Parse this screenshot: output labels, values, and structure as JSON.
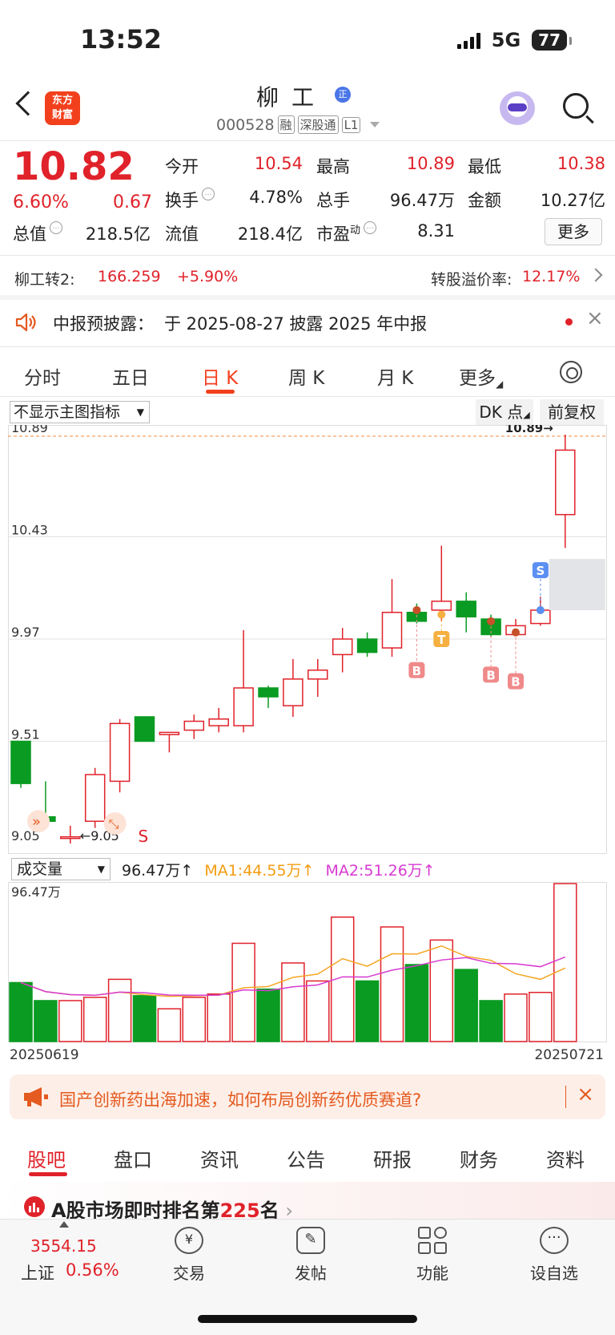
{
  "status_bar": {
    "time": "13:52",
    "network": "5G",
    "battery": "77"
  },
  "header": {
    "logo_line1": "东方",
    "logo_line2": "财富",
    "name": "柳工",
    "badge": "正",
    "code": "000528",
    "tags": [
      "融",
      "深股通",
      "L1"
    ]
  },
  "quote": {
    "price": "10.82",
    "change_pct": "6.60%",
    "change": "0.67",
    "open_label": "今开",
    "open": "10.54",
    "high_label": "最高",
    "high": "10.89",
    "low_label": "最低",
    "low": "10.38",
    "turnover_label": "换手",
    "turnover": "4.78%",
    "volume_label": "总手",
    "volume": "96.47万",
    "amount_label": "金额",
    "amount": "10.27亿",
    "mcap_label": "总值",
    "mcap": "218.5亿",
    "float_label": "流值",
    "float": "218.4亿",
    "pe_label": "市盈",
    "pe_sup": "动",
    "pe": "8.31",
    "more": "更多"
  },
  "convertible": {
    "label": "柳工转2:",
    "price": "166.259",
    "pct": "+5.90%",
    "premium_label": "转股溢价率:",
    "premium": "12.17%"
  },
  "notice": {
    "label": "中报预披露：",
    "text": "于 2025-08-27 披露 2025 年中报"
  },
  "ktabs": [
    "分时",
    "五日",
    "日 K",
    "周 K",
    "月 K",
    "更多"
  ],
  "chart_toolbar": {
    "indicator": "不显示主图指标",
    "dk": "DK 点",
    "adjust": "前复权"
  },
  "chart_data": {
    "type": "candlestick",
    "y_ticks": [
      "10.89",
      "10.43",
      "9.97",
      "9.51",
      "9.05"
    ],
    "ylim": [
      9.05,
      10.89
    ],
    "high_marker": "10.89→",
    "low_marker": "←9.05",
    "signals": [
      "B",
      "T",
      "B",
      "B",
      "S",
      "S"
    ],
    "candles": [
      {
        "o": 9.51,
        "c": 9.32,
        "h": 9.51,
        "l": 9.3
      },
      {
        "o": 9.17,
        "c": 9.15,
        "h": 9.33,
        "l": 9.12
      },
      {
        "o": 9.08,
        "c": 9.08,
        "h": 9.13,
        "l": 9.05
      },
      {
        "o": 9.15,
        "c": 9.36,
        "h": 9.39,
        "l": 9.12
      },
      {
        "o": 9.33,
        "c": 9.59,
        "h": 9.61,
        "l": 9.28
      },
      {
        "o": 9.62,
        "c": 9.51,
        "h": 9.62,
        "l": 9.51
      },
      {
        "o": 9.54,
        "c": 9.55,
        "h": 9.55,
        "l": 9.46
      },
      {
        "o": 9.56,
        "c": 9.6,
        "h": 9.63,
        "l": 9.52
      },
      {
        "o": 9.58,
        "c": 9.61,
        "h": 9.66,
        "l": 9.55
      },
      {
        "o": 9.58,
        "c": 9.75,
        "h": 10.01,
        "l": 9.55
      },
      {
        "o": 9.75,
        "c": 9.71,
        "h": 9.76,
        "l": 9.66
      },
      {
        "o": 9.67,
        "c": 9.79,
        "h": 9.88,
        "l": 9.62
      },
      {
        "o": 9.79,
        "c": 9.83,
        "h": 9.88,
        "l": 9.71
      },
      {
        "o": 9.9,
        "c": 9.97,
        "h": 10.02,
        "l": 9.82
      },
      {
        "o": 9.97,
        "c": 9.91,
        "h": 10.0,
        "l": 9.89
      },
      {
        "o": 9.93,
        "c": 10.09,
        "h": 10.24,
        "l": 9.89
      },
      {
        "o": 10.09,
        "c": 10.05,
        "h": 10.13,
        "l": 10.04
      },
      {
        "o": 10.1,
        "c": 10.14,
        "h": 10.39,
        "l": 10.05
      },
      {
        "o": 10.14,
        "c": 10.07,
        "h": 10.18,
        "l": 10.0
      },
      {
        "o": 10.06,
        "c": 9.99,
        "h": 10.08,
        "l": 9.98
      },
      {
        "o": 9.99,
        "c": 10.03,
        "h": 10.06,
        "l": 9.99
      },
      {
        "o": 10.04,
        "c": 10.1,
        "h": 10.16,
        "l": 10.03
      },
      {
        "o": 10.53,
        "c": 10.82,
        "h": 10.89,
        "l": 10.38
      }
    ],
    "volume": {
      "label": "成交量",
      "value": "96.47万↑",
      "ma1": "MA1:44.55万↑",
      "ma2": "MA2:51.26万↑",
      "max_label": "96.47万",
      "values": [
        36,
        25,
        25,
        27,
        38,
        28,
        20,
        27,
        29,
        60,
        32,
        48,
        37,
        76,
        37,
        70,
        47,
        62,
        44,
        25,
        29,
        30,
        96.47
      ],
      "start_date": "20250619",
      "end_date": "20250721"
    },
    "colors": {
      "up": "#e0222a",
      "down": "#0a9b22",
      "ma1": "#f5a623",
      "ma2": "#d63ad1"
    }
  },
  "promo": {
    "text": "国产创新药出海加速，如何布局创新药优质赛道?",
    "close": "×"
  },
  "bottom_tabs": [
    "股吧",
    "盘口",
    "资讯",
    "公告",
    "研报",
    "财务",
    "资料"
  ],
  "rank": {
    "text_prefix": "A股市场即时排名第",
    "rank": "225",
    "text_suffix": "名"
  },
  "bottom_bar": {
    "index_value": "3554.15",
    "index_name": "上证",
    "index_pct": "0.56%",
    "items": [
      "交易",
      "发帖",
      "功能",
      "设自选"
    ]
  }
}
